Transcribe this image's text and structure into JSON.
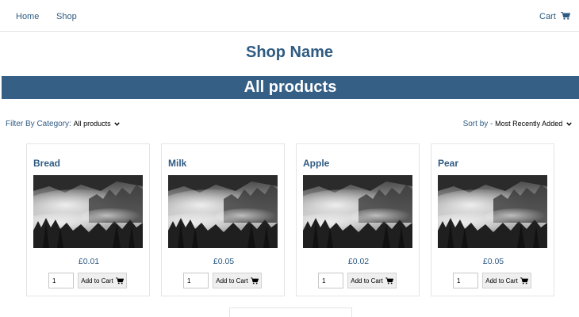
{
  "nav": {
    "home_label": "Home",
    "shop_label": "Shop",
    "cart_label": "Cart",
    "cart_icon": "shopping-cart-icon"
  },
  "header": {
    "shop_name": "Shop Name",
    "banner_title": "All products"
  },
  "filters": {
    "category_label": "Filter By Category:",
    "category_value": "All products",
    "sort_label": "Sort by -",
    "sort_value": "Most Recently Added"
  },
  "products": [
    {
      "name": "Bread",
      "price": "£0.01",
      "quantity": "1",
      "add_label": "Add to Cart",
      "image": "misty-forest-photo"
    },
    {
      "name": "Milk",
      "price": "£0.05",
      "quantity": "1",
      "add_label": "Add to Cart",
      "image": "misty-forest-photo"
    },
    {
      "name": "Apple",
      "price": "£0.02",
      "quantity": "1",
      "add_label": "Add to Cart",
      "image": "misty-forest-photo"
    },
    {
      "name": "Pear",
      "price": "£0.05",
      "quantity": "1",
      "add_label": "Add to Cart",
      "image": "misty-forest-photo"
    }
  ],
  "colors": {
    "accent": "#2f5b82",
    "banner_background": "#365f85"
  }
}
